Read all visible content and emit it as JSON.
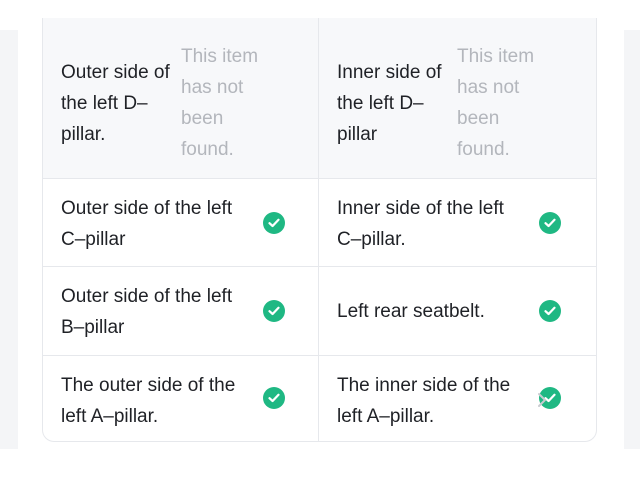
{
  "rows": [
    {
      "left": {
        "label": "Outer side of the left D–pillar.",
        "status": "missing",
        "status_text": "This item has not been found."
      },
      "right": {
        "label": "Inner side of the left D–pillar",
        "status": "missing",
        "status_text": "This item has not been found."
      }
    },
    {
      "left": {
        "label": "Outer side of the left C–pillar",
        "status": "found"
      },
      "right": {
        "label": "Inner side of the left C–pillar.",
        "status": "found"
      }
    },
    {
      "left": {
        "label": "Outer side of the left B–pillar",
        "status": "found"
      },
      "right": {
        "label": "Left rear seatbelt.",
        "status": "found"
      }
    },
    {
      "left": {
        "label": "The outer side of the left A–pillar.",
        "status": "found"
      },
      "right": {
        "label": "The inner side of the left A–pillar.",
        "status": "found"
      }
    }
  ],
  "icons": {
    "found": "check-circle-icon",
    "more": "chevron-right-icon"
  },
  "colors": {
    "check": "#1fb883",
    "missing_text": "#b3b6bc",
    "label_text": "#1f2126",
    "divider": "#e6e8ec",
    "header_row_bg": "#f7f8fa"
  }
}
